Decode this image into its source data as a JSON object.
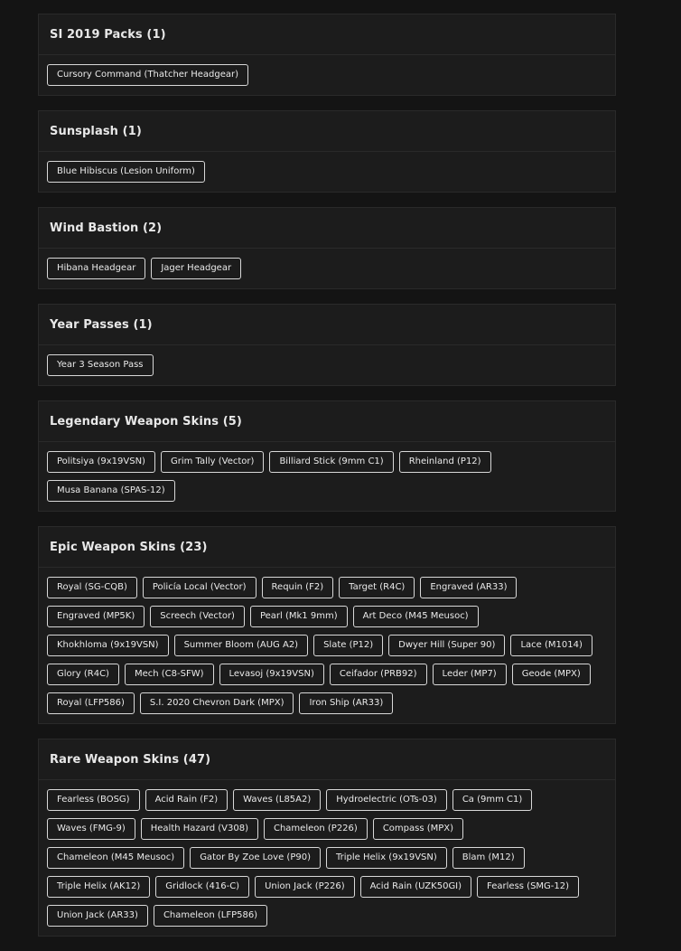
{
  "sections": [
    {
      "title": "SI 2019 Packs (1)",
      "items": [
        "Cursory Command (Thatcher Headgear)"
      ]
    },
    {
      "title": "Sunsplash (1)",
      "items": [
        "Blue Hibiscus (Lesion Uniform)"
      ]
    },
    {
      "title": "Wind Bastion (2)",
      "items": [
        "Hibana Headgear",
        "Jager Headgear"
      ]
    },
    {
      "title": "Year Passes (1)",
      "items": [
        "Year 3 Season Pass"
      ]
    },
    {
      "title": "Legendary Weapon Skins (5)",
      "items": [
        "Politsiya (9x19VSN)",
        "Grim Tally (Vector)",
        "Billiard Stick (9mm C1)",
        "Rheinland (P12)",
        "Musa Banana (SPAS-12)"
      ]
    },
    {
      "title": "Epic Weapon Skins (23)",
      "items": [
        "Royal (SG-CQB)",
        "Policía Local (Vector)",
        "Requin (F2)",
        "Target (R4C)",
        "Engraved (AR33)",
        "Engraved (MP5K)",
        "Screech (Vector)",
        "Pearl (Mk1 9mm)",
        "Art Deco (M45 Meusoc)",
        "Khokhloma (9x19VSN)",
        "Summer Bloom (AUG A2)",
        "Slate (P12)",
        "Dwyer Hill (Super 90)",
        "Lace (M1014)",
        "Glory (R4C)",
        "Mech (C8-SFW)",
        "Levasoj (9x19VSN)",
        "Ceifador (PRB92)",
        "Leder (MP7)",
        "Geode (MPX)",
        "Royal (LFP586)",
        "S.I. 2020 Chevron Dark (MPX)",
        "Iron Ship (AR33)"
      ]
    },
    {
      "title": "Rare Weapon Skins (47)",
      "items": [
        "Fearless (BOSG)",
        "Acid Rain (F2)",
        "Waves (L85A2)",
        "Hydroelectric (OTs-03)",
        "Ca (9mm C1)",
        "Waves (FMG-9)",
        "Health Hazard (V308)",
        "Chameleon (P226)",
        "Compass (MPX)",
        "Chameleon (M45 Meusoc)",
        "Gator By Zoe Love (P90)",
        "Triple Helix (9x19VSN)",
        "Blam (M12)",
        "Triple Helix (AK12)",
        "Gridlock (416-C)",
        "Union Jack (P226)",
        "Acid Rain (UZK50GI)",
        "Fearless (SMG-12)",
        "Union Jack (AR33)",
        "Chameleon (LFP586)"
      ]
    }
  ]
}
